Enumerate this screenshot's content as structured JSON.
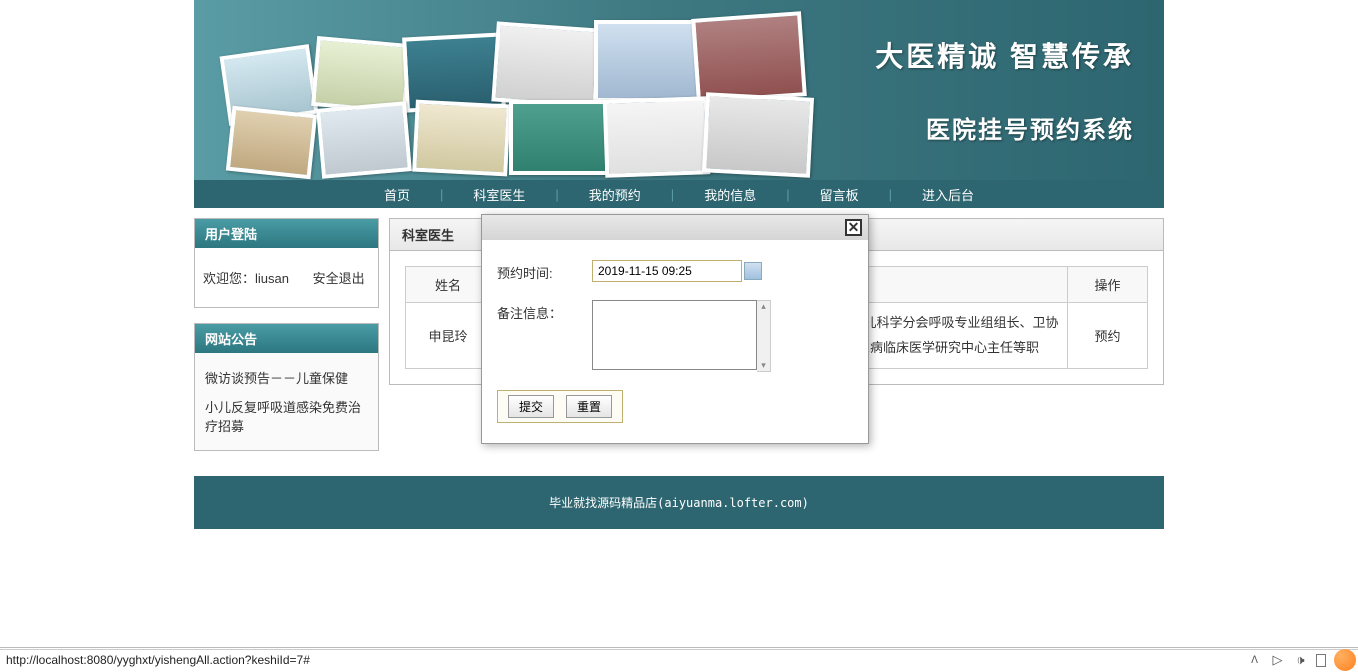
{
  "banner": {
    "line1": "大医精诚  智慧传承",
    "line2": "医院挂号预约系统"
  },
  "nav": {
    "items": [
      "首页",
      "科室医生",
      "我的预约",
      "我的信息",
      "留言板",
      "进入后台"
    ]
  },
  "sidebar": {
    "login": {
      "title": "用户登陆",
      "welcome": "欢迎您：",
      "username": "liusan",
      "logout": "安全退出"
    },
    "notice": {
      "title": "网站公告",
      "items": [
        "微访谈预告－－儿童保健",
        "小儿反复呼吸道感染免费治疗招募"
      ]
    }
  },
  "main": {
    "title": "科室医生",
    "headers": {
      "name": "姓名",
      "action": "操作"
    },
    "row": {
      "name": "申昆玲",
      "desc": "师。现任中华医学会儿科学分会州儿科学会常务委员、中国医师儿科学分会呼吸专业组组长、卫协会呼吸医师分会常务委员、中长、北京医师协会儿科专业专家病临床医学研究中心主任等职",
      "action": "预约"
    }
  },
  "modal": {
    "time_label": "预约时间:",
    "time_value": "2019-11-15 09:25",
    "remark_label": "备注信息：",
    "remark_value": "",
    "submit": "提交",
    "reset": "重置"
  },
  "footer": {
    "text": "毕业就找源码精品店(aiyuanma.lofter.com)"
  },
  "status": {
    "url": "http://localhost:8080/yyghxt/yishengAll.action?keshiId=7#"
  }
}
